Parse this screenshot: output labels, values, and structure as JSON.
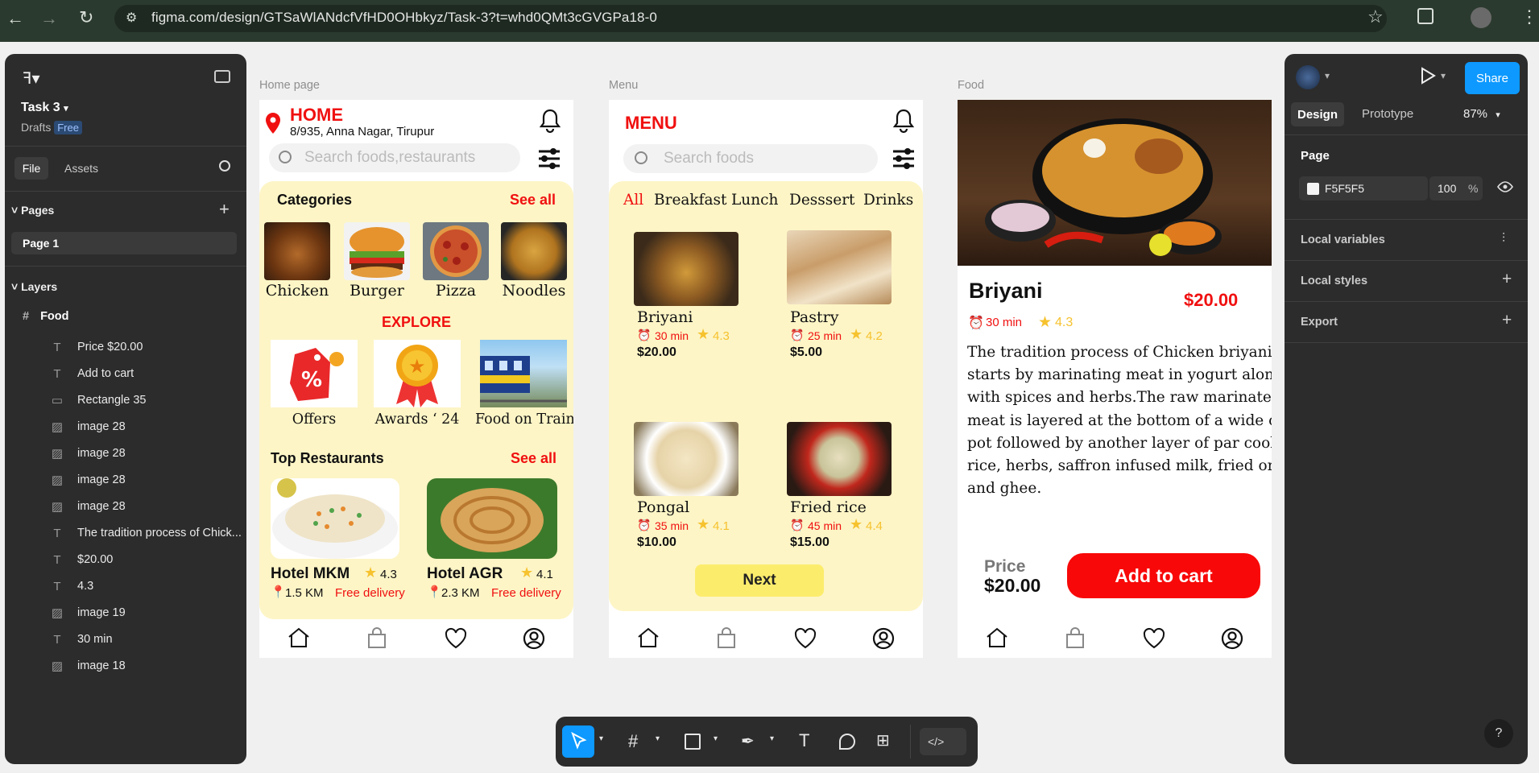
{
  "browser": {
    "url": "figma.com/design/GTSaWlANdcfVfHD0OHbkyz/Task-3?t=whd0QMt3cGVGPa18-0"
  },
  "left_panel": {
    "file_name": "Task 3",
    "drafts": "Drafts",
    "plan_badge": "Free",
    "tabs": [
      "File",
      "Assets"
    ],
    "pages_label": "Pages",
    "page_item": "Page 1",
    "layers_label": "Layers",
    "frame_layer": "Food",
    "layers": [
      {
        "type": "text",
        "label": "Price $20.00"
      },
      {
        "type": "text",
        "label": "Add to cart"
      },
      {
        "type": "rect",
        "label": "Rectangle 35"
      },
      {
        "type": "image",
        "label": "image 28"
      },
      {
        "type": "image",
        "label": "image 28"
      },
      {
        "type": "image",
        "label": "image 28"
      },
      {
        "type": "image",
        "label": "image 28"
      },
      {
        "type": "text",
        "label": "The tradition process of Chick..."
      },
      {
        "type": "text",
        "label": "$20.00"
      },
      {
        "type": "text",
        "label": "4.3"
      },
      {
        "type": "image",
        "label": "image 19"
      },
      {
        "type": "text",
        "label": "30 min"
      },
      {
        "type": "image",
        "label": "image 18"
      }
    ]
  },
  "frame_labels": {
    "home": "Home page",
    "menu": "Menu",
    "food": "Food"
  },
  "home": {
    "title": "HOME",
    "address": "8/935, Anna Nagar, Tirupur",
    "search_placeholder": "Search foods,restaurants",
    "categories_title": "Categories",
    "see_all": "See all",
    "categories": [
      "Chicken",
      "Burger",
      "Pizza",
      "Noodles"
    ],
    "explore_title": "EXPLORE",
    "explore": [
      "Offers",
      "Awards ‘ 24",
      "Food on Train"
    ],
    "top_title": "Top Restaurants",
    "top_see_all": "See all",
    "restaurants": [
      {
        "name": "Hotel MKM",
        "rating": "4.3",
        "distance": "1.5 KM",
        "delivery": "Free delivery"
      },
      {
        "name": "Hotel AGR",
        "rating": "4.1",
        "distance": "2.3 KM",
        "delivery": "Free delivery"
      }
    ]
  },
  "menu": {
    "title": "MENU",
    "search_placeholder": "Search foods",
    "tabs": [
      "All",
      "Breakfast",
      "Lunch",
      "Desssert",
      "Drinks"
    ],
    "items": [
      {
        "name": "Briyani",
        "time": "30 min",
        "rating": "4.3",
        "price": "$20.00"
      },
      {
        "name": "Pastry",
        "time": "25 min",
        "rating": "4.2",
        "price": "$5.00"
      },
      {
        "name": "Pongal",
        "time": "35 min",
        "rating": "4.1",
        "price": "$10.00"
      },
      {
        "name": "Fried rice",
        "time": "45 min",
        "rating": "4.4",
        "price": "$15.00"
      }
    ],
    "next": "Next"
  },
  "food": {
    "name": "Briyani",
    "price": "$20.00",
    "time": "30 min",
    "rating": "4.3",
    "desc_lines": [
      "The tradition process of Chicken briyani is",
      "starts by marinating meat in yogurt along",
      "with spices and herbs.The raw marinated",
      "meat is layered at the bottom of a wide of",
      "pot followed by another layer of par cooked",
      "rice, herbs, saffron infused milk, fried onion",
      "and ghee."
    ],
    "price_label": "Price",
    "price_value": "$20.00",
    "cart_button": "Add to cart"
  },
  "right_panel": {
    "share": "Share",
    "tabs": [
      "Design",
      "Prototype"
    ],
    "zoom": "87%",
    "page_label": "Page",
    "fill_hex": "F5F5F5",
    "opacity": "100",
    "percent": "%",
    "sections": [
      "Local variables",
      "Local styles",
      "Export"
    ]
  },
  "help": "?",
  "colors": {
    "accent_red": "#f01010",
    "cream": "#fdf5c6",
    "figma_blue": "#0d99ff",
    "star": "#f6c22e"
  }
}
